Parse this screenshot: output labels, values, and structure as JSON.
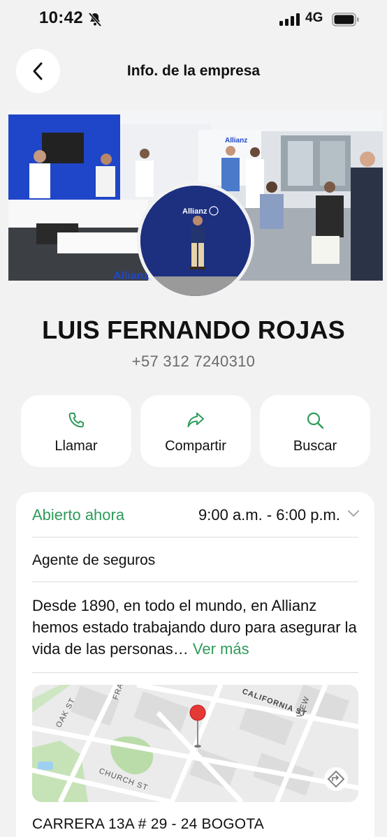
{
  "status_bar": {
    "time": "10:42",
    "network": "4G"
  },
  "nav": {
    "title": "Info. de la empresa"
  },
  "business": {
    "name": "LUIS FERNANDO ROJAS",
    "phone": "+57 312 7240310",
    "cover_brand": "Allianz",
    "avatar_brand": "Allianz"
  },
  "actions": [
    {
      "label": "Llamar",
      "icon": "phone-icon"
    },
    {
      "label": "Compartir",
      "icon": "share-icon"
    },
    {
      "label": "Buscar",
      "icon": "search-icon"
    }
  ],
  "info": {
    "status": "Abierto ahora",
    "hours": "9:00 a.m. - 6:00 p.m.",
    "category": "Agente de seguros",
    "description": "Desde 1890, en todo el mundo, en Allianz hemos estado trabajando duro para asegurar la vida de las personas…",
    "see_more": "Ver más",
    "address": "CARRERA 13A # 29 - 24 BOGOTA"
  },
  "map": {
    "streets": [
      "OAK ST",
      "FRA",
      "CALIFORNIA ST",
      "VIEW",
      "CHURCH ST"
    ]
  },
  "colors": {
    "accent_green": "#2e9b5a",
    "background": "#f2f2f2",
    "pin_red": "#e53935"
  }
}
